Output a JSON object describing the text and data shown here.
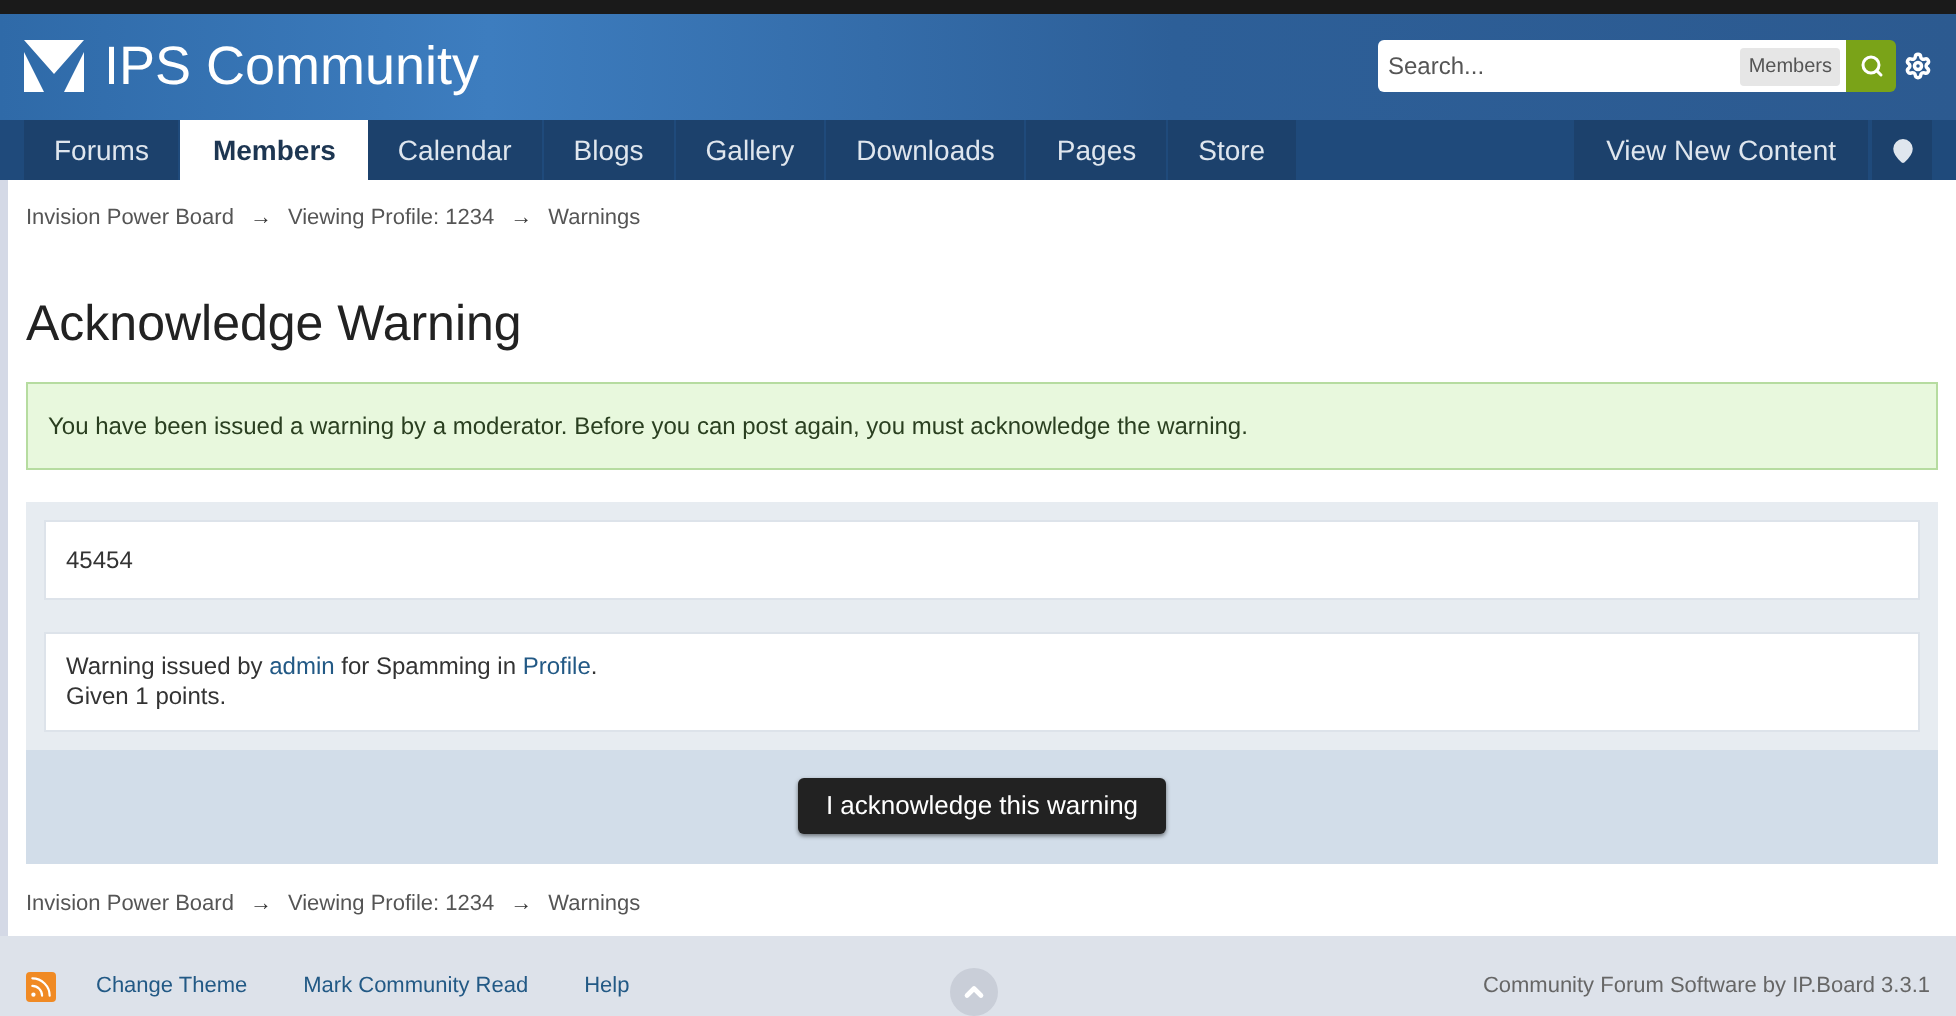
{
  "header": {
    "logo_text": "IPS Community",
    "search": {
      "placeholder": "Search...",
      "scope": "Members"
    }
  },
  "nav": {
    "tabs": [
      {
        "label": "Forums",
        "selected": false
      },
      {
        "label": "Members",
        "selected": true
      },
      {
        "label": "Calendar",
        "selected": false
      },
      {
        "label": "Blogs",
        "selected": false
      },
      {
        "label": "Gallery",
        "selected": false
      },
      {
        "label": "Downloads",
        "selected": false
      },
      {
        "label": "Pages",
        "selected": false
      },
      {
        "label": "Store",
        "selected": false
      }
    ],
    "right_link": "View New Content"
  },
  "breadcrumb_top": [
    {
      "kind": "link",
      "text": "Invision Power Board"
    },
    {
      "kind": "separator",
      "text": "→"
    },
    {
      "kind": "link",
      "text": "Viewing Profile: 1234"
    },
    {
      "kind": "separator",
      "text": "→"
    },
    {
      "kind": "link",
      "text": "Warnings"
    }
  ],
  "title": "Acknowledge Warning",
  "notice": "You have been issued a warning by a moderator. Before you can post again, you must acknowledge the warning.",
  "warning_note": "45454",
  "warning_details": {
    "parts": [
      {
        "kind": "text",
        "text": "Warning issued by"
      },
      {
        "kind": "link",
        "text": "admin"
      },
      {
        "kind": "text",
        "text": "for Spamming in"
      },
      {
        "kind": "link",
        "text": "Profile"
      },
      {
        "kind": "text",
        "text": "."
      }
    ],
    "points": "Given 1 points."
  },
  "acknowledge_button": "I acknowledge this warning",
  "breadcrumb_bottom": [
    {
      "kind": "link",
      "text": "Invision Power Board"
    },
    {
      "kind": "separator",
      "text": "→"
    },
    {
      "kind": "link",
      "text": "Viewing Profile: 1234"
    },
    {
      "kind": "separator",
      "text": "→"
    },
    {
      "kind": "link",
      "text": "Warnings"
    }
  ],
  "footer": {
    "links": [
      "Change Theme",
      "Mark Community Read",
      "Help"
    ],
    "credit": "Community Forum Software by IP.Board 3.3.1"
  }
}
